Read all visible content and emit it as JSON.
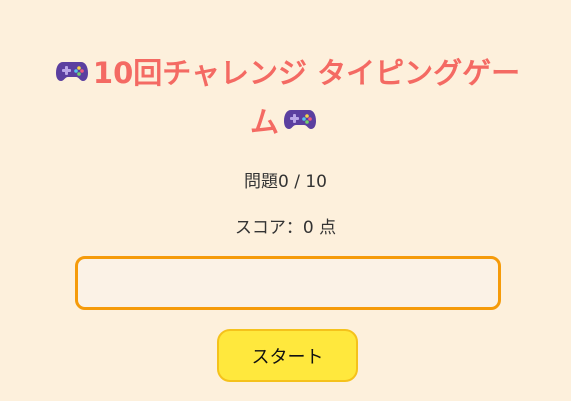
{
  "header": {
    "title": "10回チャレンジ タイピングゲーム",
    "icon_left": "gamepad-icon",
    "icon_right": "gamepad-icon"
  },
  "status": {
    "question_counter": "問題0 / 10",
    "score": "スコア：0 点"
  },
  "typing": {
    "value": "",
    "placeholder": ""
  },
  "controls": {
    "start_label": "スタート"
  },
  "colors": {
    "background": "#fdf0dc",
    "title": "#f46a63",
    "input_border": "#f59b0a",
    "input_bg": "#fbf2e6",
    "button_bg": "#ffe83d",
    "button_border": "#f5c21b"
  }
}
